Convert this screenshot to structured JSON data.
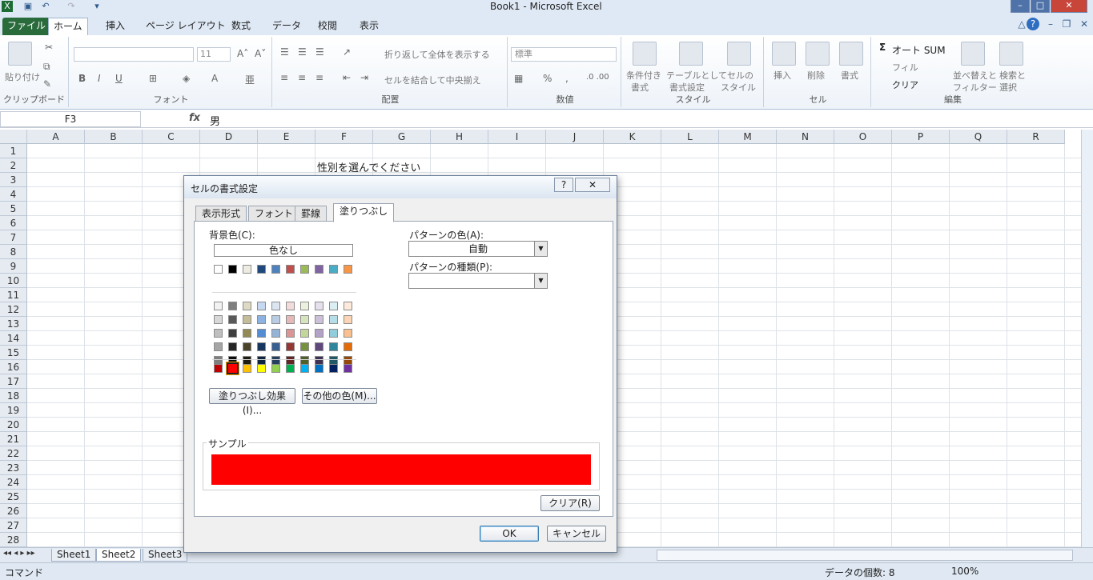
{
  "window": {
    "title": "Book1 - Microsoft Excel",
    "min": "–",
    "max": "□",
    "close": "✕"
  },
  "ribbon_tabs": [
    "ファイル",
    "ホーム",
    "挿入",
    "ページ レイアウト",
    "数式",
    "データ",
    "校閲",
    "表示"
  ],
  "ribbon": {
    "clipboard": {
      "label": "クリップボード",
      "paste": "貼り付け"
    },
    "font": {
      "label": "フォント",
      "size": "11",
      "bold": "B",
      "italic": "I",
      "underline": "U"
    },
    "alignment": {
      "label": "配置",
      "wrap": "折り返して全体を表示する",
      "merge": "セルを結合して中央揃え"
    },
    "number": {
      "label": "数値",
      "format": "標準",
      "percent": "%",
      "comma": ","
    },
    "styles": {
      "label": "スタイル",
      "cond1": "条件付き",
      "cond2": "書式",
      "table1": "テーブルとして",
      "table2": "書式設定",
      "cell1": "セルの",
      "cell2": "スタイル"
    },
    "cells": {
      "label": "セル",
      "insert": "挿入",
      "delete": "削除",
      "format": "書式"
    },
    "editing": {
      "label": "編集",
      "autosum": "オート SUM",
      "fill": "フィル",
      "clear": "クリア",
      "sort1": "並べ替えと",
      "sort2": "フィルター",
      "find1": "検索と",
      "find2": "選択"
    }
  },
  "formula_bar": {
    "name_box": "F3",
    "fx": "fx",
    "value": "男"
  },
  "grid": {
    "columns": [
      "A",
      "B",
      "C",
      "D",
      "E",
      "F",
      "G",
      "H",
      "I",
      "J",
      "K",
      "L",
      "M",
      "N",
      "O",
      "P",
      "Q",
      "R"
    ],
    "rows": [
      "1",
      "2",
      "3",
      "4",
      "5",
      "6",
      "7",
      "8",
      "9",
      "10",
      "11",
      "12",
      "13",
      "14",
      "15",
      "16",
      "17",
      "18",
      "19",
      "20",
      "21",
      "22",
      "23",
      "24",
      "25",
      "26",
      "27",
      "28"
    ],
    "cell_f2": "性別を選んでください"
  },
  "sheets": [
    "Sheet1",
    "Sheet2",
    "Sheet3"
  ],
  "status": {
    "left": "コマンド",
    "count": "データの個数: 8",
    "zoom": "100%"
  },
  "dialog": {
    "title": "セルの書式設定",
    "help": "?",
    "close": "✕",
    "tabs": [
      "表示形式",
      "フォント",
      "罫線",
      "塗りつぶし"
    ],
    "bg_label": "背景色(C):",
    "no_color": "色なし",
    "pattern_color_label": "パターンの色(A):",
    "pattern_color_value": "自動",
    "pattern_type_label": "パターンの種類(P):",
    "fill_effects": "塗りつぶし効果(I)...",
    "more_colors": "その他の色(M)...",
    "sample_label": "サンプル",
    "sample_color": "#ff0000",
    "clear": "クリア(R)",
    "ok": "OK",
    "cancel": "キャンセル",
    "theme_row": [
      "#ffffff",
      "#000000",
      "#eeece1",
      "#1f497d",
      "#4f81bd",
      "#c0504d",
      "#9bbb59",
      "#8064a2",
      "#4bacc6",
      "#f79646"
    ],
    "tints": [
      [
        "#f2f2f2",
        "#7f7f7f",
        "#ddd9c3",
        "#c6d9f0",
        "#dbe5f1",
        "#f2dcdb",
        "#ebf1dd",
        "#e5e0ec",
        "#dbeef3",
        "#fdeada"
      ],
      [
        "#d8d8d8",
        "#595959",
        "#c4bd97",
        "#8db3e2",
        "#b8cce4",
        "#e5b9b7",
        "#d7e3bc",
        "#ccc1d9",
        "#b7dde8",
        "#fbd5b5"
      ],
      [
        "#bfbfbf",
        "#3f3f3f",
        "#938953",
        "#548dd4",
        "#95b3d7",
        "#d99694",
        "#c3d69b",
        "#b2a2c7",
        "#92cddc",
        "#fac08f"
      ],
      [
        "#a5a5a5",
        "#262626",
        "#494429",
        "#17365d",
        "#366092",
        "#953734",
        "#76923c",
        "#5f497a",
        "#31859b",
        "#e36c09"
      ],
      [
        "#7f7f7f",
        "#0c0c0c",
        "#1d1b10",
        "#0f243e",
        "#244061",
        "#632423",
        "#4f6128",
        "#3f3151",
        "#205867",
        "#974806"
      ]
    ],
    "standard_row": [
      "#c00000",
      "#ff0000",
      "#ffc000",
      "#ffff00",
      "#92d050",
      "#00b050",
      "#00b0f0",
      "#0070c0",
      "#002060",
      "#7030a0"
    ],
    "selected_standard_index": 1
  }
}
